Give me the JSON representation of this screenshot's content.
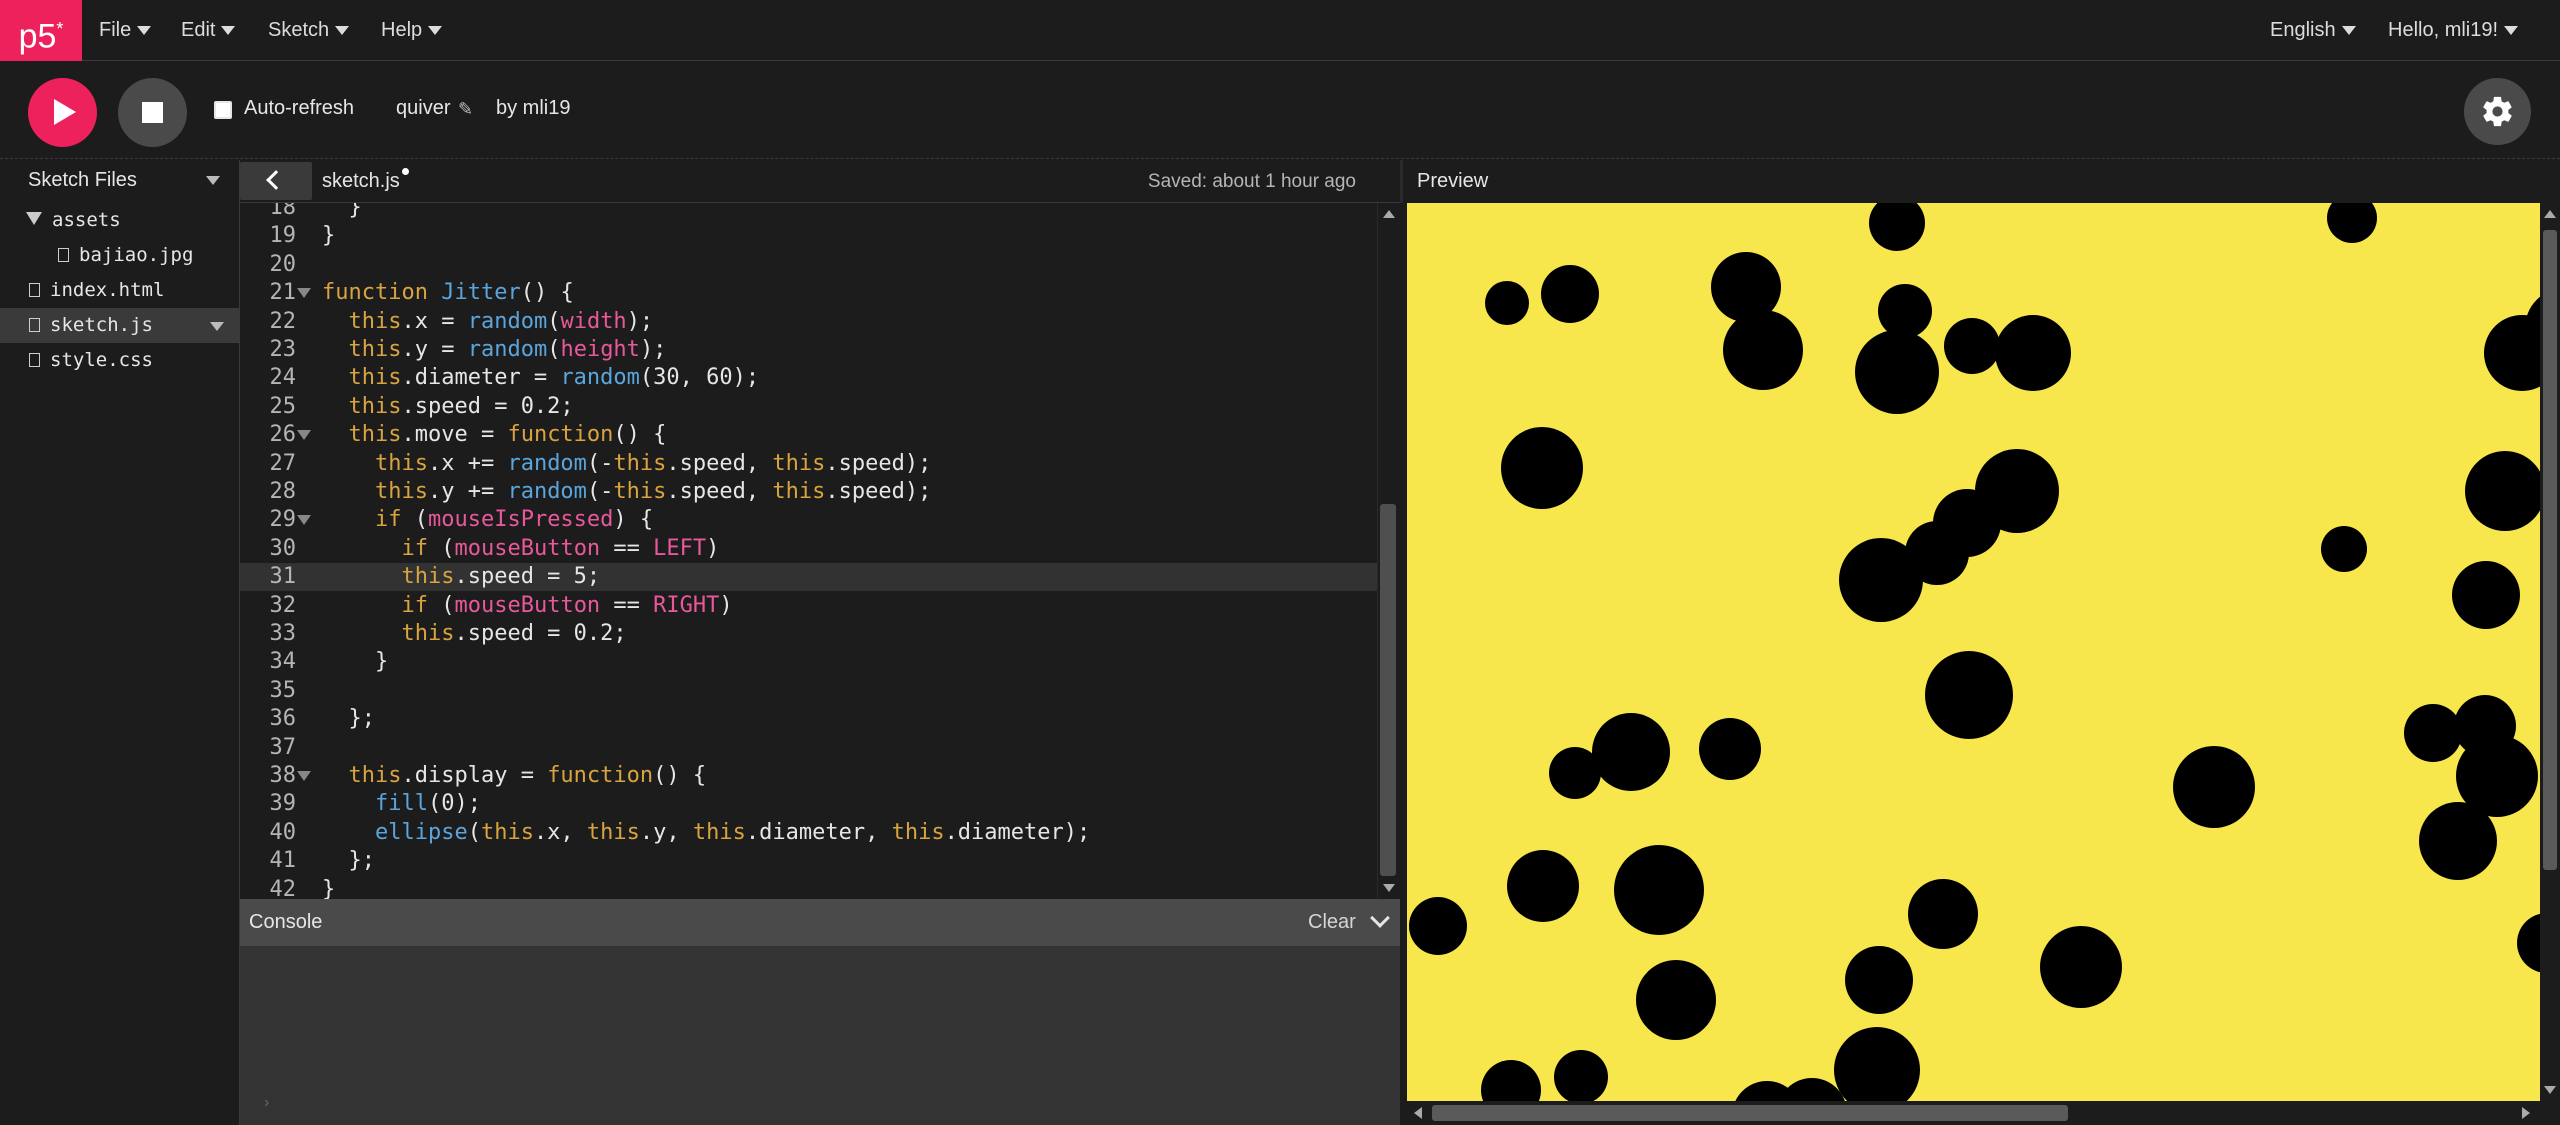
{
  "nav": {
    "logo": "p5",
    "logo_mark": "*",
    "menus": [
      "File",
      "Edit",
      "Sketch",
      "Help"
    ],
    "language": "English",
    "user_greeting": "Hello, mli19!"
  },
  "toolbar": {
    "autorefresh_label": "Auto-refresh",
    "autorefresh_checked": false,
    "sketch_name": "quiver",
    "author": "by mli19"
  },
  "sidebar": {
    "title": "Sketch Files",
    "files": [
      {
        "name": "assets",
        "type": "folder"
      },
      {
        "name": "bajiao.jpg",
        "type": "file"
      },
      {
        "name": "index.html",
        "type": "file"
      },
      {
        "name": "sketch.js",
        "type": "file",
        "active": true
      },
      {
        "name": "style.css",
        "type": "file"
      }
    ]
  },
  "editor": {
    "tab_name": "sketch.js",
    "save_status": "Saved: about 1 hour ago",
    "current_line": 31,
    "lines": [
      {
        "n": "18",
        "code": "  }"
      },
      {
        "n": "19",
        "code": "}"
      },
      {
        "n": "20",
        "code": ""
      },
      {
        "n": "21",
        "code": "function Jitter() {"
      },
      {
        "n": "22",
        "code": "  this.x = random(width);"
      },
      {
        "n": "23",
        "code": "  this.y = random(height);"
      },
      {
        "n": "24",
        "code": "  this.diameter = random(30, 60);"
      },
      {
        "n": "25",
        "code": "  this.speed = 0.2;"
      },
      {
        "n": "26",
        "code": "  this.move = function() {"
      },
      {
        "n": "27",
        "code": "    this.x += random(-this.speed, this.speed);"
      },
      {
        "n": "28",
        "code": "    this.y += random(-this.speed, this.speed);"
      },
      {
        "n": "29",
        "code": "    if (mouseIsPressed) {"
      },
      {
        "n": "30",
        "code": "      if (mouseButton == LEFT)"
      },
      {
        "n": "31",
        "code": "      this.speed = 5;"
      },
      {
        "n": "32",
        "code": "      if (mouseButton == RIGHT)"
      },
      {
        "n": "33",
        "code": "      this.speed = 0.2;"
      },
      {
        "n": "34",
        "code": "    }"
      },
      {
        "n": "35",
        "code": ""
      },
      {
        "n": "36",
        "code": "  };"
      },
      {
        "n": "37",
        "code": ""
      },
      {
        "n": "38",
        "code": "  this.display = function() {"
      },
      {
        "n": "39",
        "code": "    fill(0);"
      },
      {
        "n": "40",
        "code": "    ellipse(this.x, this.y, this.diameter, this.diameter);"
      },
      {
        "n": "41",
        "code": "  };"
      },
      {
        "n": "42",
        "code": "}"
      }
    ],
    "folded_lines": [
      "21",
      "26",
      "29",
      "38"
    ]
  },
  "console": {
    "title": "Console",
    "clear_label": "Clear",
    "prompt": "›"
  },
  "preview": {
    "title": "Preview",
    "background": "#f7e74c",
    "dot_color": "#000000"
  },
  "colors": {
    "accent": "#ed225d",
    "keyword": "#d9a43f",
    "function": "#5aa5dc",
    "variable": "#e8589b"
  }
}
